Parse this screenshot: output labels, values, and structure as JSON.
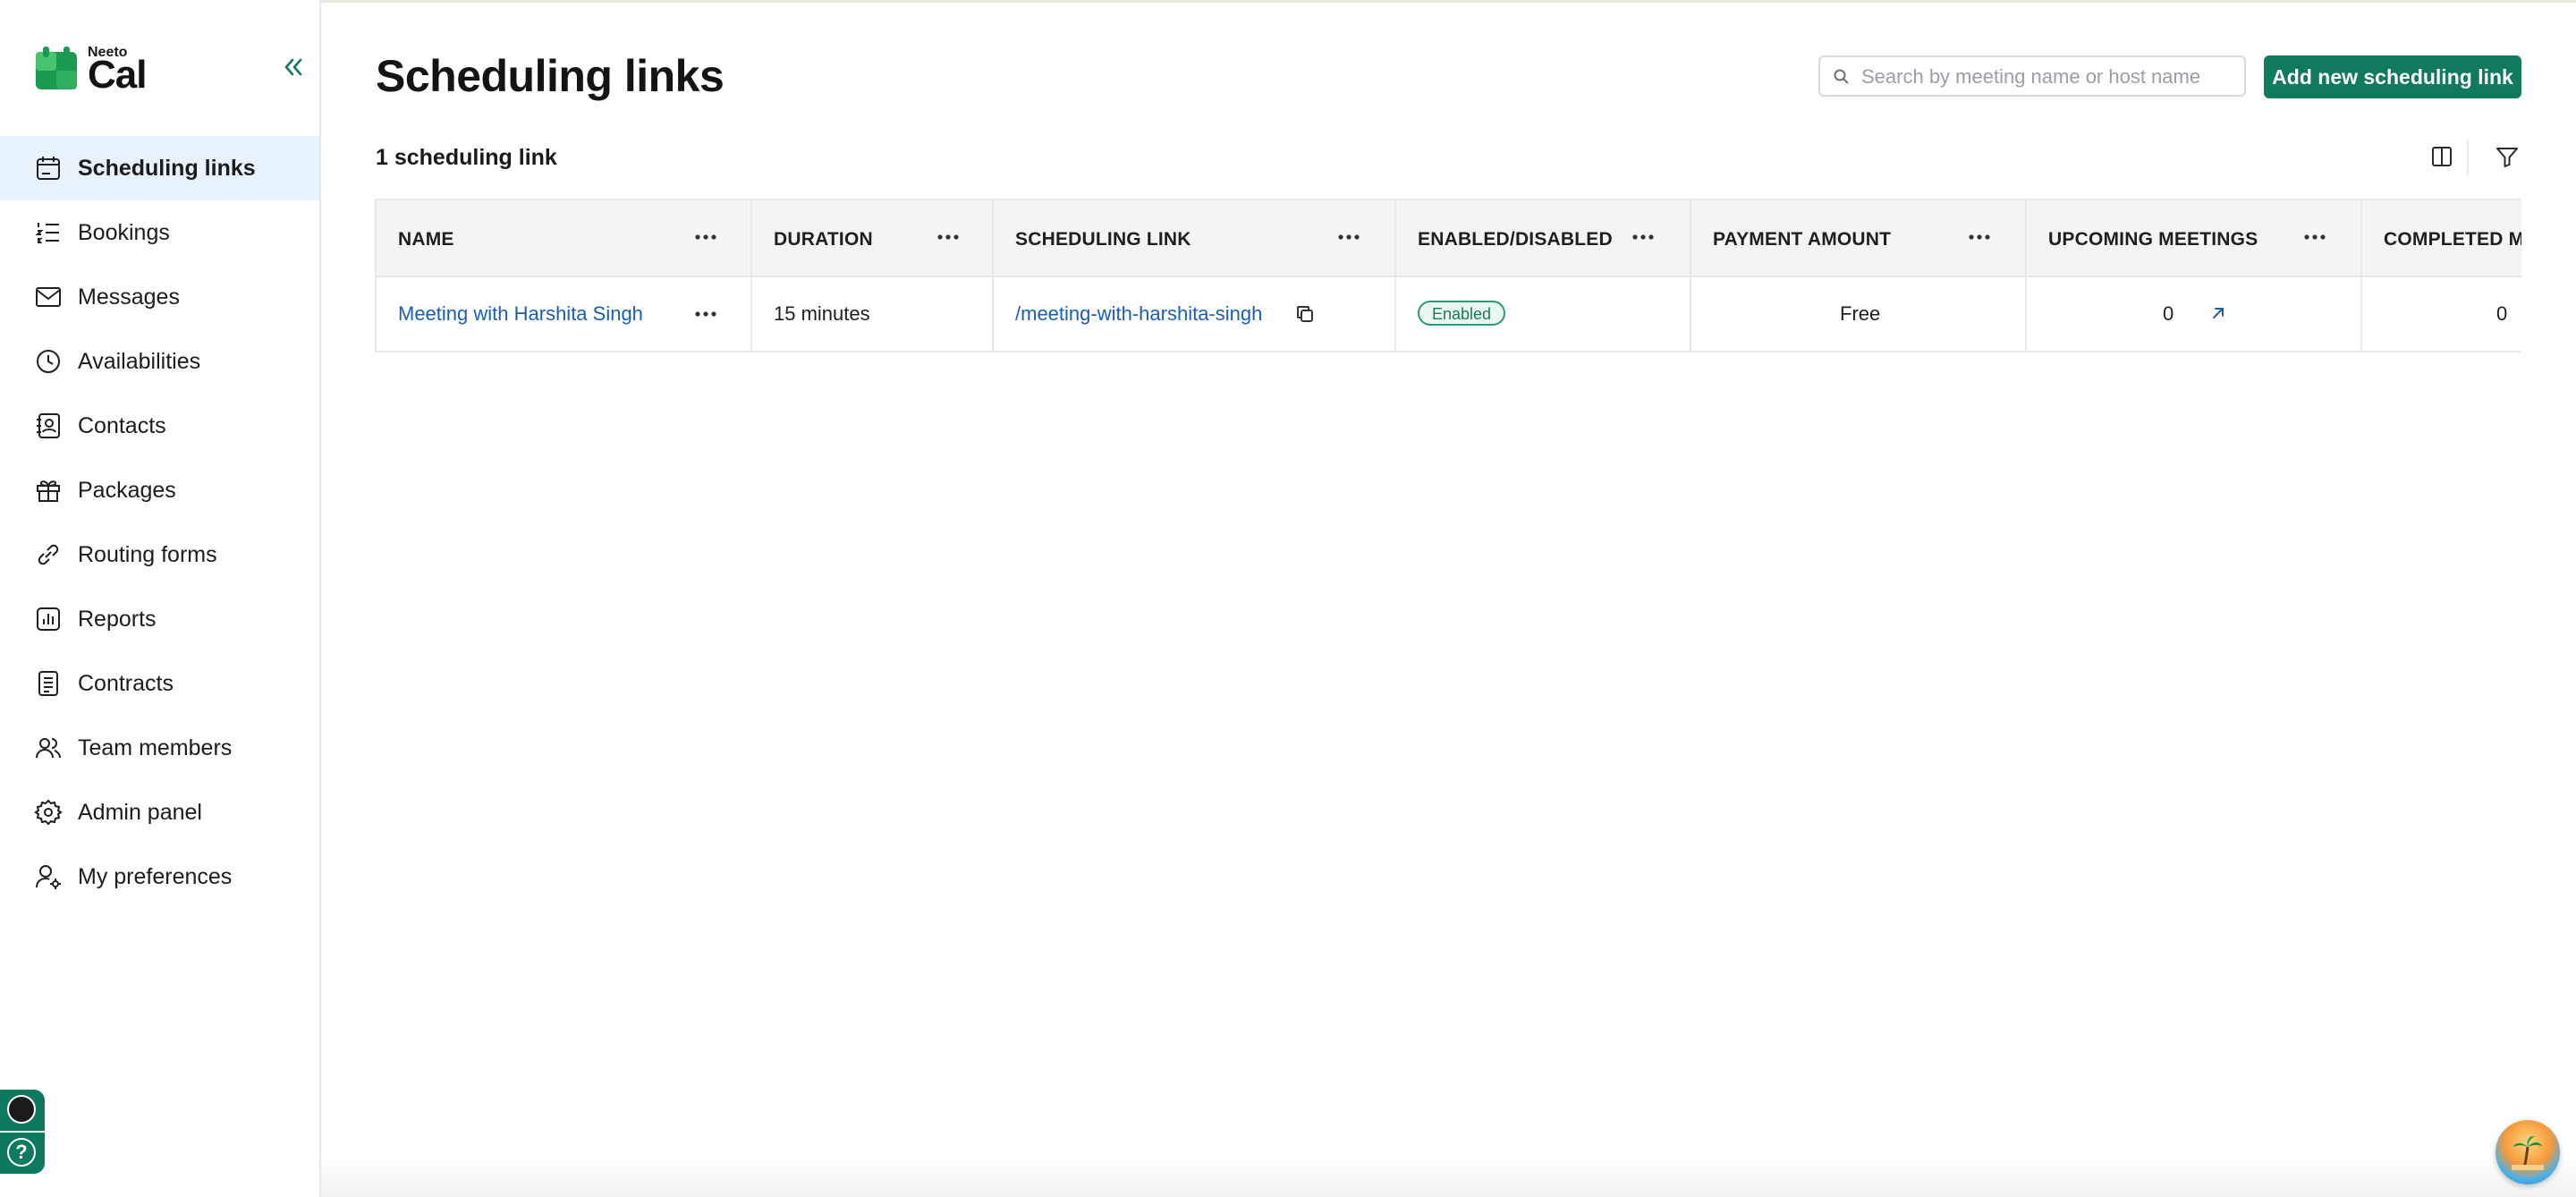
{
  "app": {
    "brand_small": "Neeto",
    "brand_big": "Cal",
    "accent_color": "#0f7a5e"
  },
  "sidebar": {
    "items": [
      {
        "label": "Scheduling links",
        "icon": "calendar-icon",
        "active": true
      },
      {
        "label": "Bookings",
        "icon": "list-numbered-icon",
        "active": false
      },
      {
        "label": "Messages",
        "icon": "mail-icon",
        "active": false
      },
      {
        "label": "Availabilities",
        "icon": "clock-icon",
        "active": false
      },
      {
        "label": "Contacts",
        "icon": "contact-book-icon",
        "active": false
      },
      {
        "label": "Packages",
        "icon": "gift-icon",
        "active": false
      },
      {
        "label": "Routing forms",
        "icon": "link-icon",
        "active": false
      },
      {
        "label": "Reports",
        "icon": "report-icon",
        "active": false
      },
      {
        "label": "Contracts",
        "icon": "document-icon",
        "active": false
      },
      {
        "label": "Team members",
        "icon": "users-icon",
        "active": false
      },
      {
        "label": "Admin panel",
        "icon": "gear-icon",
        "active": false
      },
      {
        "label": "My preferences",
        "icon": "user-settings-icon",
        "active": false
      }
    ],
    "help_label": "?"
  },
  "header": {
    "title": "Scheduling links",
    "search_placeholder": "Search by meeting name or host name",
    "add_button": "Add new scheduling link"
  },
  "summary": {
    "count_text": "1 scheduling link"
  },
  "table": {
    "columns": [
      "NAME",
      "DURATION",
      "SCHEDULING LINK",
      "ENABLED/DISABLED",
      "PAYMENT AMOUNT",
      "UPCOMING MEETINGS",
      "COMPLETED ME"
    ],
    "rows": [
      {
        "name": "Meeting with Harshita Singh",
        "duration": "15 minutes",
        "link": "/meeting-with-harshita-singh",
        "status": "Enabled",
        "payment": "Free",
        "upcoming": "0",
        "completed": "0"
      }
    ]
  }
}
